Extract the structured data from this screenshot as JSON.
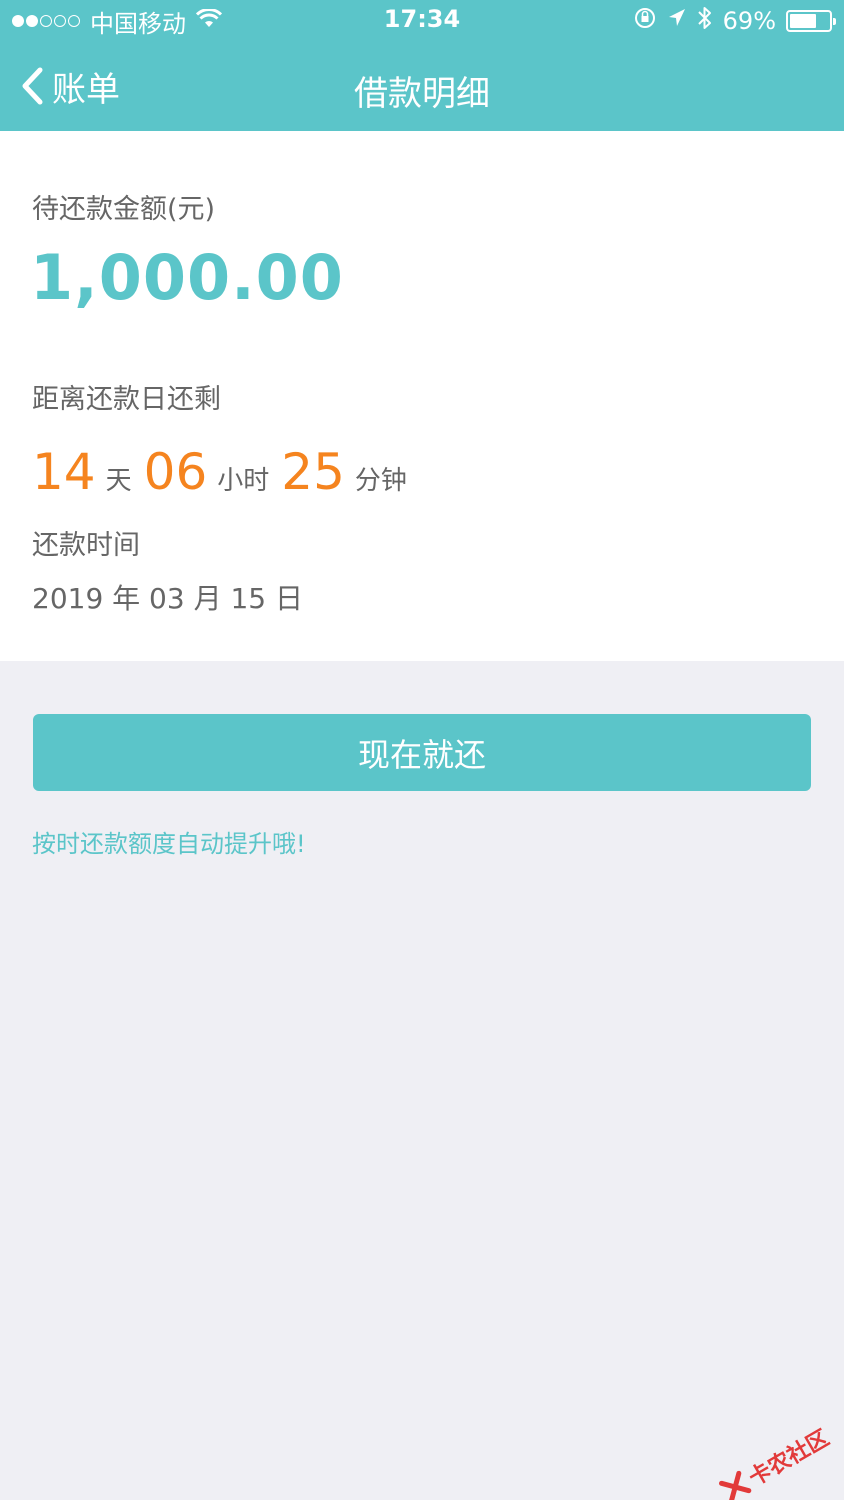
{
  "status_bar": {
    "carrier": "中国移动",
    "time": "17:34",
    "battery": "69%",
    "battery_level": 0.69,
    "signal_bars_full": 2,
    "signal_bars_total": 5,
    "icons": [
      "wifi-icon",
      "orientation-lock-icon",
      "location-icon",
      "bluetooth-icon",
      "battery-icon"
    ]
  },
  "nav": {
    "back_label": "账单",
    "title": "借款明细"
  },
  "loan": {
    "amount_label": "待还款金额(元)",
    "amount": "1,000.00",
    "countdown_label": "距离还款日还剩",
    "countdown": {
      "days": "14",
      "days_unit": "天",
      "hours": "06",
      "hours_unit": "小时",
      "minutes": "25",
      "minutes_unit": "分钟"
    },
    "due_label": "还款时间",
    "due_date": "2019 年 03 月 15 日"
  },
  "actions": {
    "pay_now": "现在就还",
    "tip": "按时还款额度自动提升哦!"
  },
  "watermark": "卡农社区",
  "colors": {
    "accent": "#5bc5c9",
    "countdown": "#f5841f",
    "page_bg": "#efeff4"
  }
}
